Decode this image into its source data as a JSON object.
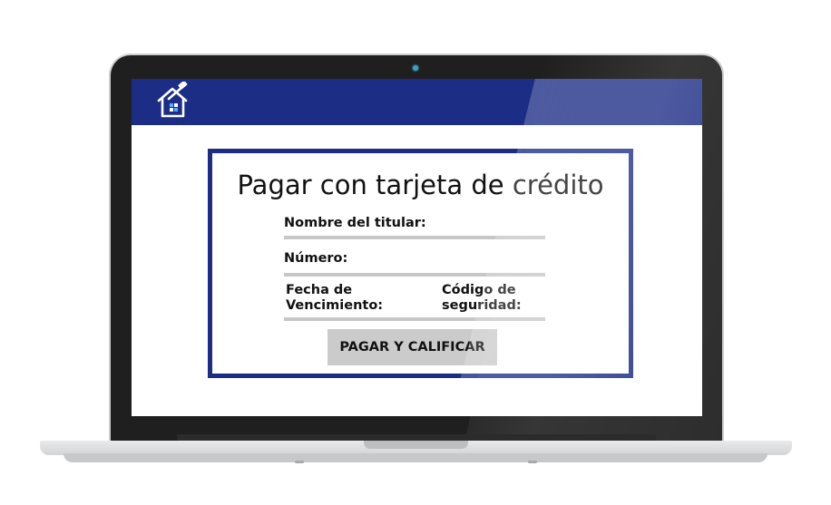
{
  "header": {
    "logo_icon": "house-hammer-logo-icon",
    "color": "#1c2d86"
  },
  "payment": {
    "title": "Pagar con tarjeta de crédito",
    "holder_label": "Nombre del titular:",
    "number_label": "Número:",
    "expiry_label_line1": "Fecha de",
    "expiry_label_line2": "Vencimiento:",
    "cvv_label_line1": "Código de",
    "cvv_label_line2": "seguridad:",
    "submit_label": "PAGAR Y CALIFICAR"
  },
  "colors": {
    "accent": "#1c2d86",
    "field_line": "#c7c7c7",
    "button_bg": "#cbcbcb"
  }
}
